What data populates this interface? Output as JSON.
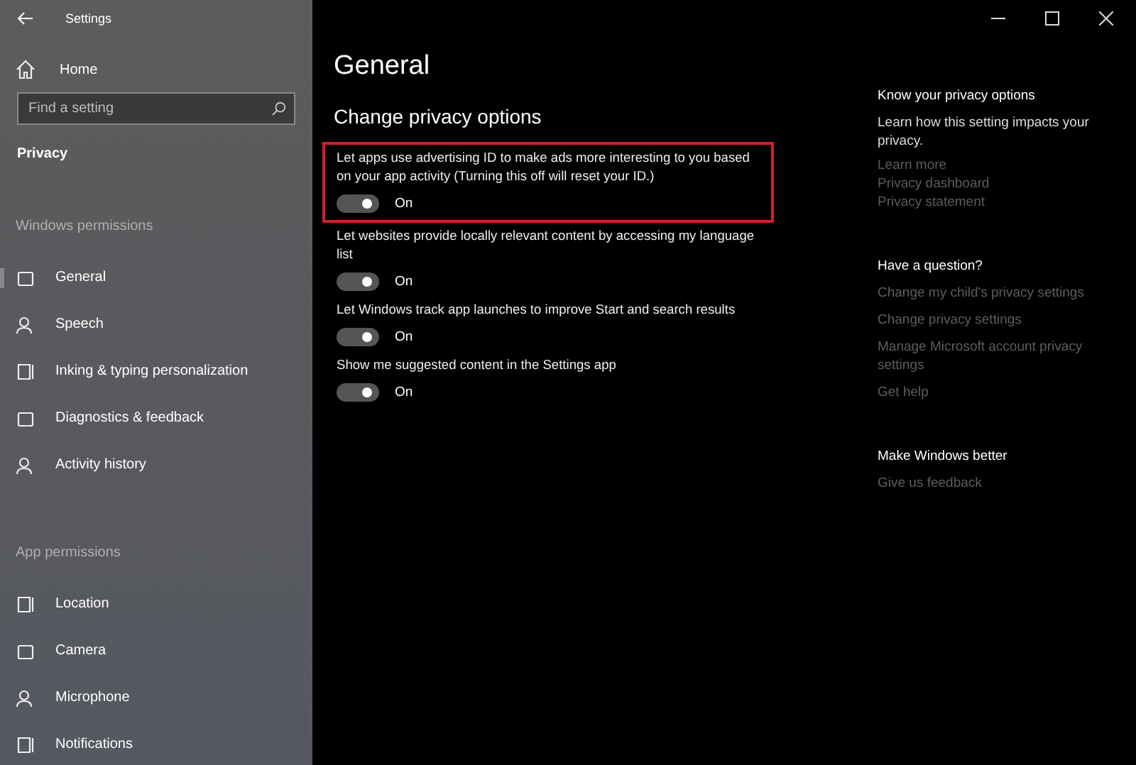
{
  "window": {
    "title": "Settings"
  },
  "sidebar": {
    "home": "Home",
    "search": {
      "placeholder": "Find a setting"
    },
    "section": "Privacy",
    "groups": [
      {
        "header": "Windows permissions",
        "items": [
          {
            "label": "General",
            "selected": true
          },
          {
            "label": "Speech",
            "selected": false
          },
          {
            "label": "Inking & typing personalization",
            "selected": false
          },
          {
            "label": "Diagnostics & feedback",
            "selected": false
          },
          {
            "label": "Activity history",
            "selected": false
          }
        ]
      },
      {
        "header": "App permissions",
        "items": [
          {
            "label": "Location",
            "selected": false
          },
          {
            "label": "Camera",
            "selected": false
          },
          {
            "label": "Microphone",
            "selected": false
          },
          {
            "label": "Notifications",
            "selected": false
          }
        ]
      }
    ]
  },
  "main": {
    "title": "General",
    "subtitle": "Change privacy options",
    "options": [
      {
        "text": "Let apps use advertising ID to make ads more interesting to you based on your app activity (Turning this off will reset your ID.)",
        "on": true,
        "state": "On",
        "highlighted": true
      },
      {
        "text": "Let websites provide locally relevant content by accessing my language list",
        "on": true,
        "state": "On",
        "highlighted": false
      },
      {
        "text": "Let Windows track app launches to improve Start and search results",
        "on": true,
        "state": "On",
        "highlighted": false
      },
      {
        "text": "Show me suggested content in the Settings app",
        "on": true,
        "state": "On",
        "highlighted": false
      }
    ]
  },
  "aside": [
    {
      "heading": "Know your privacy options",
      "text": "Learn how this setting impacts your privacy.",
      "links": [
        "Learn more",
        "Privacy dashboard",
        "Privacy statement"
      ]
    },
    {
      "heading": "Have a question?",
      "links": [
        "Change my child's privacy settings",
        "Change privacy settings",
        "Manage Microsoft account privacy settings",
        "Get help"
      ]
    },
    {
      "heading": "Make Windows better",
      "links": [
        "Give us feedback"
      ]
    }
  ]
}
